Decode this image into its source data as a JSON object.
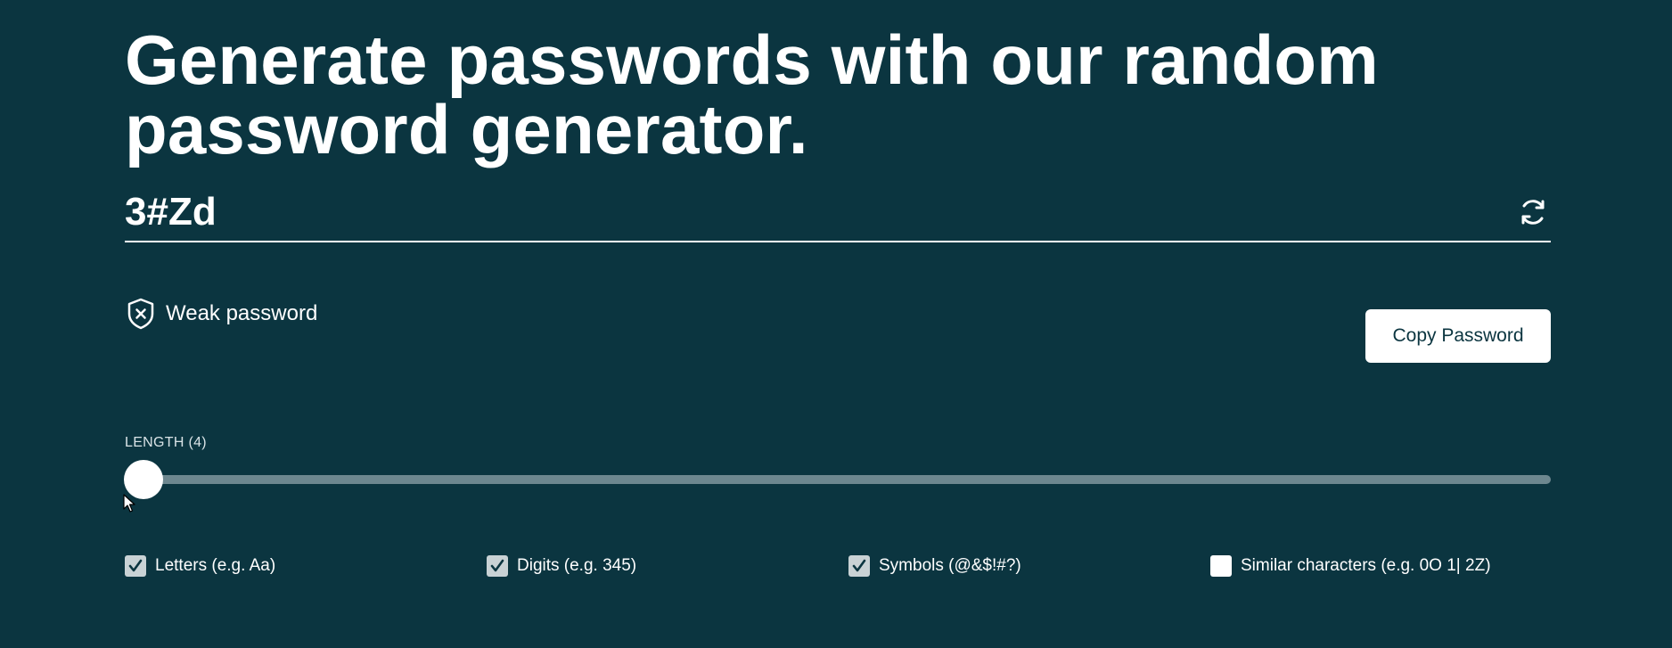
{
  "title": {
    "line1": "Generate passwords with our random",
    "line2": "password generator."
  },
  "password": {
    "value": "3#Zd",
    "refresh_icon": "refresh-icon"
  },
  "strength": {
    "label": "Weak password",
    "icon": "shield-x-icon"
  },
  "copy_button": {
    "label": "Copy Password"
  },
  "length": {
    "label": "LENGTH (4)",
    "value": 4
  },
  "options": [
    {
      "label": "Letters (e.g. Aa)",
      "checked": true
    },
    {
      "label": "Digits (e.g. 345)",
      "checked": true
    },
    {
      "label": "Symbols (@&$!#?)",
      "checked": true
    },
    {
      "label": "Similar characters (e.g. 0O 1| 2Z)",
      "checked": false
    }
  ],
  "colors": {
    "background": "#0b3540",
    "text": "#ffffff",
    "slider_track": "#6d878f",
    "checkbox_checked": "#c9d2d5"
  }
}
